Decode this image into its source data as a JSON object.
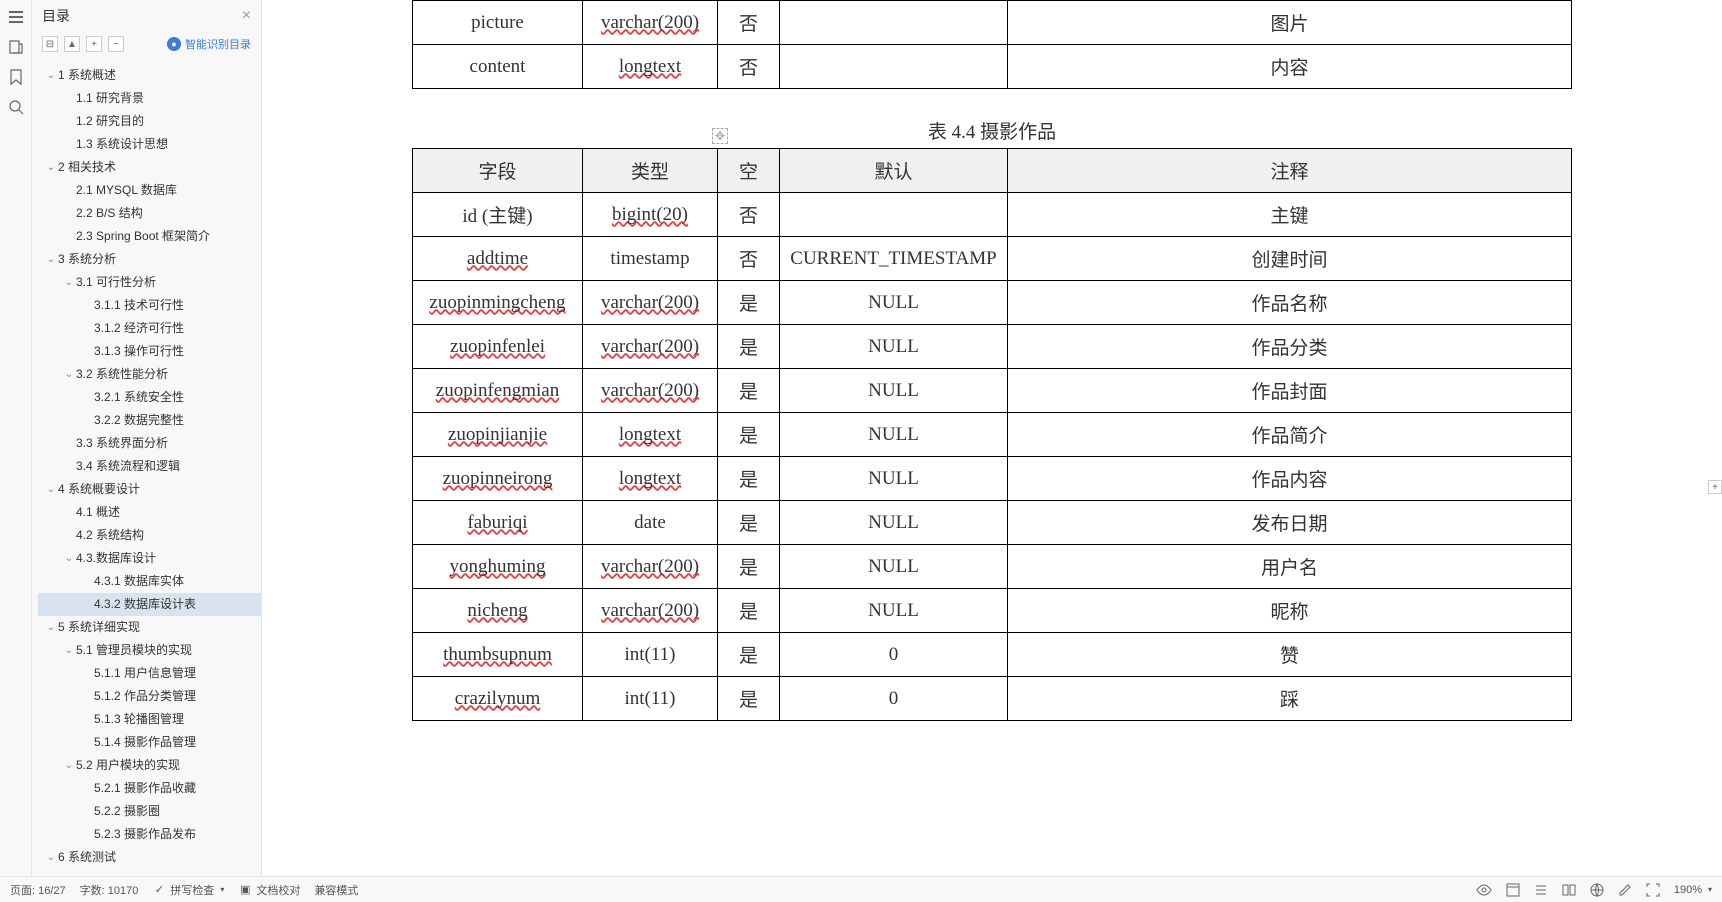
{
  "sidebar": {
    "title": "目录",
    "smart_toc": "智能识别目录",
    "items": [
      {
        "label": "1 系统概述",
        "depth": 0,
        "exp": true
      },
      {
        "label": "1.1 研究背景",
        "depth": 1
      },
      {
        "label": "1.2 研究目的",
        "depth": 1
      },
      {
        "label": "1.3 系统设计思想",
        "depth": 1
      },
      {
        "label": "2 相关技术",
        "depth": 0,
        "exp": true
      },
      {
        "label": "2.1 MYSQL 数据库",
        "depth": 1
      },
      {
        "label": "2.2 B/S 结构",
        "depth": 1
      },
      {
        "label": "2.3 Spring Boot 框架简介",
        "depth": 1
      },
      {
        "label": "3 系统分析",
        "depth": 0,
        "exp": true
      },
      {
        "label": "3.1 可行性分析",
        "depth": 1,
        "exp": true
      },
      {
        "label": "3.1.1 技术可行性",
        "depth": 2
      },
      {
        "label": "3.1.2 经济可行性",
        "depth": 2
      },
      {
        "label": "3.1.3 操作可行性",
        "depth": 2
      },
      {
        "label": "3.2 系统性能分析",
        "depth": 1,
        "exp": true
      },
      {
        "label": "3.2.1 系统安全性",
        "depth": 2
      },
      {
        "label": "3.2.2 数据完整性",
        "depth": 2
      },
      {
        "label": "3.3 系统界面分析",
        "depth": 1
      },
      {
        "label": "3.4 系统流程和逻辑",
        "depth": 1
      },
      {
        "label": "4 系统概要设计",
        "depth": 0,
        "exp": true
      },
      {
        "label": "4.1 概述",
        "depth": 1
      },
      {
        "label": "4.2 系统结构",
        "depth": 1
      },
      {
        "label": "4.3.数据库设计",
        "depth": 1,
        "exp": true
      },
      {
        "label": "4.3.1 数据库实体",
        "depth": 2
      },
      {
        "label": "4.3.2 数据库设计表",
        "depth": 2,
        "active": true
      },
      {
        "label": "5 系统详细实现",
        "depth": 0,
        "exp": true
      },
      {
        "label": "5.1 管理员模块的实现",
        "depth": 1,
        "exp": true
      },
      {
        "label": "5.1.1 用户信息管理",
        "depth": 2
      },
      {
        "label": "5.1.2 作品分类管理",
        "depth": 2
      },
      {
        "label": "5.1.3 轮播图管理",
        "depth": 2
      },
      {
        "label": "5.1.4 摄影作品管理",
        "depth": 2
      },
      {
        "label": "5.2 用户模块的实现",
        "depth": 1,
        "exp": true
      },
      {
        "label": "5.2.1 摄影作品收藏",
        "depth": 2
      },
      {
        "label": "5.2.2 摄影圈",
        "depth": 2
      },
      {
        "label": "5.2.3 摄影作品发布",
        "depth": 2
      },
      {
        "label": "6 系统测试",
        "depth": 0,
        "exp": true
      }
    ]
  },
  "doc": {
    "table_top": {
      "rows": [
        {
          "field": "picture",
          "type": "varchar(200)",
          "null": "否",
          "def": "",
          "comment": "图片",
          "wavy_type": true
        },
        {
          "field": "content",
          "type": "longtext",
          "null": "否",
          "def": "",
          "comment": "内容",
          "wavy_type": true
        }
      ]
    },
    "caption": "表 4.4  摄影作品",
    "table_main": {
      "headers": [
        "字段",
        "类型",
        "空",
        "默认",
        "注释"
      ],
      "rows": [
        {
          "field": "id (主键)",
          "type": "bigint(20)",
          "null": "否",
          "def": "",
          "comment": "主键",
          "wavy_type": true
        },
        {
          "field": "addtime",
          "type": "timestamp",
          "null": "否",
          "def": "CURRENT_TIMESTAMP",
          "comment": "创建时间",
          "wavy_field": true
        },
        {
          "field": "zuopinmingcheng",
          "type": "varchar(200)",
          "null": "是",
          "def": "NULL",
          "comment": "作品名称",
          "wavy_field": true,
          "wavy_type": true
        },
        {
          "field": "zuopinfenlei",
          "type": "varchar(200)",
          "null": "是",
          "def": "NULL",
          "comment": "作品分类",
          "wavy_field": true,
          "wavy_type": true
        },
        {
          "field": "zuopinfengmian",
          "type": "varchar(200)",
          "null": "是",
          "def": "NULL",
          "comment": "作品封面",
          "wavy_field": true,
          "wavy_type": true
        },
        {
          "field": "zuopinjianjie",
          "type": "longtext",
          "null": "是",
          "def": "NULL",
          "comment": "作品简介",
          "wavy_field": true,
          "wavy_type": true
        },
        {
          "field": "zuopinneirong",
          "type": "longtext",
          "null": "是",
          "def": "NULL",
          "comment": "作品内容",
          "wavy_field": true,
          "wavy_type": true
        },
        {
          "field": "faburiqi",
          "type": "date",
          "null": "是",
          "def": "NULL",
          "comment": "发布日期",
          "wavy_field": true
        },
        {
          "field": "yonghuming",
          "type": "varchar(200)",
          "null": "是",
          "def": "NULL",
          "comment": "用户名",
          "wavy_field": true,
          "wavy_type": true
        },
        {
          "field": "nicheng",
          "type": "varchar(200)",
          "null": "是",
          "def": "NULL",
          "comment": "昵称",
          "wavy_field": true,
          "wavy_type": true
        },
        {
          "field": "thumbsupnum",
          "type": "int(11)",
          "null": "是",
          "def": "0",
          "comment": "赞",
          "wavy_field": true
        },
        {
          "field": "crazilynum",
          "type": "int(11)",
          "null": "是",
          "def": "0",
          "comment": "踩",
          "wavy_field": true
        }
      ]
    }
  },
  "statusbar": {
    "page": "页面: 16/27",
    "words": "字数: 10170",
    "spellcheck": "拼写检查",
    "proofread": "文档校对",
    "compat": "兼容模式",
    "zoom": "190%"
  }
}
